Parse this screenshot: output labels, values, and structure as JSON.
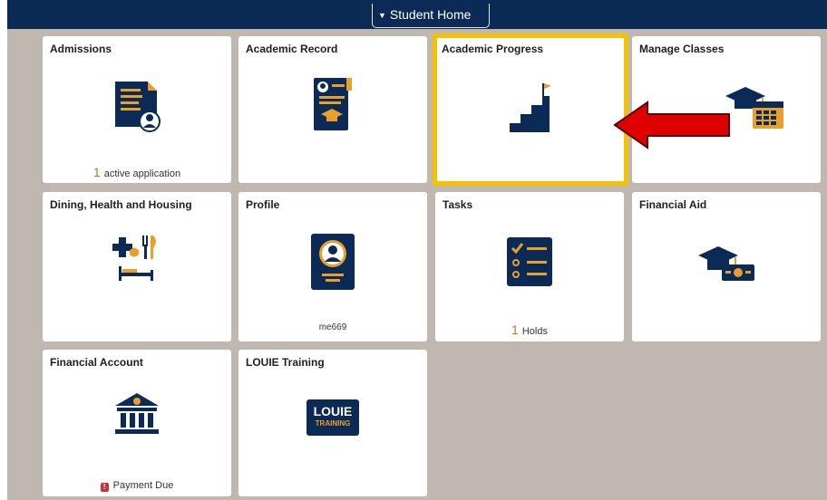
{
  "header": {
    "dropdown_label": "Student Home"
  },
  "tiles": {
    "admissions": {
      "title": "Admissions",
      "count": "1",
      "caption": "active application"
    },
    "academic_record": {
      "title": "Academic Record"
    },
    "academic_progress": {
      "title": "Academic Progress"
    },
    "manage_classes": {
      "title": "Manage Classes"
    },
    "dining": {
      "title": "Dining, Health and Housing"
    },
    "profile": {
      "title": "Profile",
      "caption": "me669"
    },
    "tasks": {
      "title": "Tasks",
      "count": "1",
      "caption": "Holds"
    },
    "financial_aid": {
      "title": "Financial Aid"
    },
    "financial_account": {
      "title": "Financial Account",
      "caption": "Payment Due"
    },
    "louie_training": {
      "title": "LOUIE Training",
      "logo_line1": "LOUIE",
      "logo_line2": "TRAINING"
    }
  },
  "colors": {
    "navy": "#0b2a55",
    "gold": "#f5c200",
    "accent": "#e8a02a",
    "arrow": "#e00000"
  }
}
